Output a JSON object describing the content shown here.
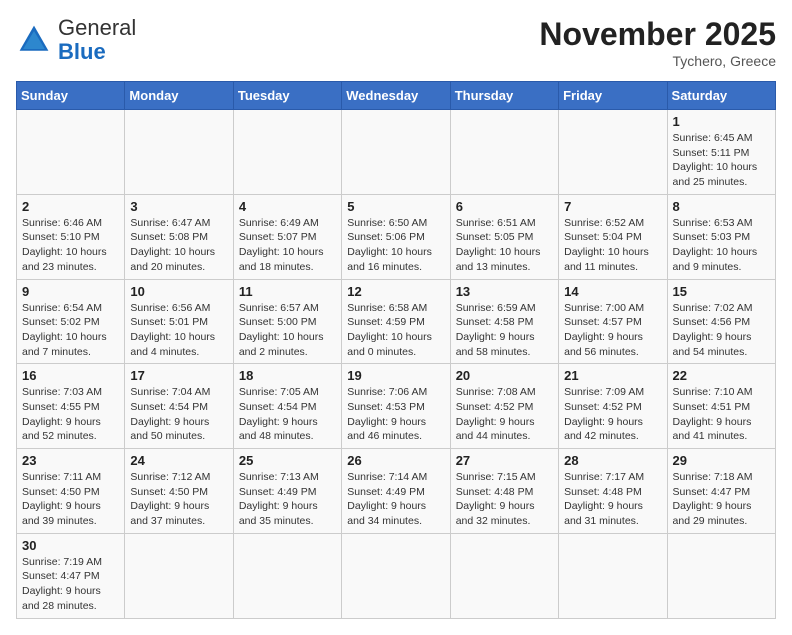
{
  "header": {
    "logo_general": "General",
    "logo_blue": "Blue",
    "month_title": "November 2025",
    "location": "Tychero, Greece"
  },
  "weekdays": [
    "Sunday",
    "Monday",
    "Tuesday",
    "Wednesday",
    "Thursday",
    "Friday",
    "Saturday"
  ],
  "weeks": [
    [
      {
        "day": "",
        "info": ""
      },
      {
        "day": "",
        "info": ""
      },
      {
        "day": "",
        "info": ""
      },
      {
        "day": "",
        "info": ""
      },
      {
        "day": "",
        "info": ""
      },
      {
        "day": "",
        "info": ""
      },
      {
        "day": "1",
        "info": "Sunrise: 6:45 AM\nSunset: 5:11 PM\nDaylight: 10 hours and 25 minutes."
      }
    ],
    [
      {
        "day": "2",
        "info": "Sunrise: 6:46 AM\nSunset: 5:10 PM\nDaylight: 10 hours and 23 minutes."
      },
      {
        "day": "3",
        "info": "Sunrise: 6:47 AM\nSunset: 5:08 PM\nDaylight: 10 hours and 20 minutes."
      },
      {
        "day": "4",
        "info": "Sunrise: 6:49 AM\nSunset: 5:07 PM\nDaylight: 10 hours and 18 minutes."
      },
      {
        "day": "5",
        "info": "Sunrise: 6:50 AM\nSunset: 5:06 PM\nDaylight: 10 hours and 16 minutes."
      },
      {
        "day": "6",
        "info": "Sunrise: 6:51 AM\nSunset: 5:05 PM\nDaylight: 10 hours and 13 minutes."
      },
      {
        "day": "7",
        "info": "Sunrise: 6:52 AM\nSunset: 5:04 PM\nDaylight: 10 hours and 11 minutes."
      },
      {
        "day": "8",
        "info": "Sunrise: 6:53 AM\nSunset: 5:03 PM\nDaylight: 10 hours and 9 minutes."
      }
    ],
    [
      {
        "day": "9",
        "info": "Sunrise: 6:54 AM\nSunset: 5:02 PM\nDaylight: 10 hours and 7 minutes."
      },
      {
        "day": "10",
        "info": "Sunrise: 6:56 AM\nSunset: 5:01 PM\nDaylight: 10 hours and 4 minutes."
      },
      {
        "day": "11",
        "info": "Sunrise: 6:57 AM\nSunset: 5:00 PM\nDaylight: 10 hours and 2 minutes."
      },
      {
        "day": "12",
        "info": "Sunrise: 6:58 AM\nSunset: 4:59 PM\nDaylight: 10 hours and 0 minutes."
      },
      {
        "day": "13",
        "info": "Sunrise: 6:59 AM\nSunset: 4:58 PM\nDaylight: 9 hours and 58 minutes."
      },
      {
        "day": "14",
        "info": "Sunrise: 7:00 AM\nSunset: 4:57 PM\nDaylight: 9 hours and 56 minutes."
      },
      {
        "day": "15",
        "info": "Sunrise: 7:02 AM\nSunset: 4:56 PM\nDaylight: 9 hours and 54 minutes."
      }
    ],
    [
      {
        "day": "16",
        "info": "Sunrise: 7:03 AM\nSunset: 4:55 PM\nDaylight: 9 hours and 52 minutes."
      },
      {
        "day": "17",
        "info": "Sunrise: 7:04 AM\nSunset: 4:54 PM\nDaylight: 9 hours and 50 minutes."
      },
      {
        "day": "18",
        "info": "Sunrise: 7:05 AM\nSunset: 4:54 PM\nDaylight: 9 hours and 48 minutes."
      },
      {
        "day": "19",
        "info": "Sunrise: 7:06 AM\nSunset: 4:53 PM\nDaylight: 9 hours and 46 minutes."
      },
      {
        "day": "20",
        "info": "Sunrise: 7:08 AM\nSunset: 4:52 PM\nDaylight: 9 hours and 44 minutes."
      },
      {
        "day": "21",
        "info": "Sunrise: 7:09 AM\nSunset: 4:52 PM\nDaylight: 9 hours and 42 minutes."
      },
      {
        "day": "22",
        "info": "Sunrise: 7:10 AM\nSunset: 4:51 PM\nDaylight: 9 hours and 41 minutes."
      }
    ],
    [
      {
        "day": "23",
        "info": "Sunrise: 7:11 AM\nSunset: 4:50 PM\nDaylight: 9 hours and 39 minutes."
      },
      {
        "day": "24",
        "info": "Sunrise: 7:12 AM\nSunset: 4:50 PM\nDaylight: 9 hours and 37 minutes."
      },
      {
        "day": "25",
        "info": "Sunrise: 7:13 AM\nSunset: 4:49 PM\nDaylight: 9 hours and 35 minutes."
      },
      {
        "day": "26",
        "info": "Sunrise: 7:14 AM\nSunset: 4:49 PM\nDaylight: 9 hours and 34 minutes."
      },
      {
        "day": "27",
        "info": "Sunrise: 7:15 AM\nSunset: 4:48 PM\nDaylight: 9 hours and 32 minutes."
      },
      {
        "day": "28",
        "info": "Sunrise: 7:17 AM\nSunset: 4:48 PM\nDaylight: 9 hours and 31 minutes."
      },
      {
        "day": "29",
        "info": "Sunrise: 7:18 AM\nSunset: 4:47 PM\nDaylight: 9 hours and 29 minutes."
      }
    ],
    [
      {
        "day": "30",
        "info": "Sunrise: 7:19 AM\nSunset: 4:47 PM\nDaylight: 9 hours and 28 minutes."
      },
      {
        "day": "",
        "info": ""
      },
      {
        "day": "",
        "info": ""
      },
      {
        "day": "",
        "info": ""
      },
      {
        "day": "",
        "info": ""
      },
      {
        "day": "",
        "info": ""
      },
      {
        "day": "",
        "info": ""
      }
    ]
  ]
}
